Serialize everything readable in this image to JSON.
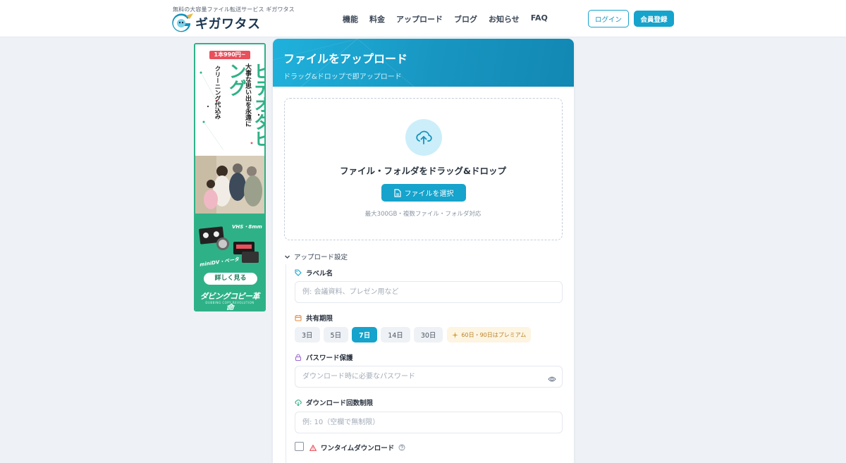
{
  "header": {
    "tagline": "無料の大容量ファイル転送サービス ギガワタス",
    "logo_text": "ギガワタス",
    "nav": [
      "機能",
      "料金",
      "アップロード",
      "ブログ",
      "お知らせ",
      "FAQ"
    ],
    "login_label": "ログイン",
    "register_label": "会員登録"
  },
  "ad": {
    "price": "1本990円~",
    "headline": "ビデオダビング",
    "line1": "大事な思い出を永遠に",
    "line2": "クリーニング代込み",
    "vhs": "VHS・8mm",
    "minidv": "miniDV・ベータ",
    "more_label": "詳しく見る",
    "brand": "ダビングコピー革命",
    "brand_sub": "DUBBING COPY REVOLUTION"
  },
  "panel": {
    "title": "ファイルをアップロード",
    "subtitle": "ドラッグ&ドロップで即アップロード",
    "drop_text": "ファイル・フォルダをドラッグ&ドロップ",
    "select_label": "ファイルを選択",
    "drop_note": "最大300GB・複数ファイル・フォルダ対応"
  },
  "settings": {
    "toggle_label": "アップロード設定",
    "label_name": {
      "label": "ラベル名",
      "placeholder": "例: 会議資料、プレゼン用など"
    },
    "share_period": {
      "label": "共有期限",
      "options": [
        "3日",
        "5日",
        "7日",
        "14日",
        "30日"
      ],
      "selected": "7日",
      "premium_note": "60日・90日はプレミアム"
    },
    "password": {
      "label": "パスワード保護",
      "placeholder": "ダウンロード時に必要なパスワード"
    },
    "download_limit": {
      "label": "ダウンロード回数制限",
      "placeholder": "例: 10（空欄で無制限）"
    },
    "one_time": {
      "label": "ワンタイムダウンロード",
      "checked": false
    }
  },
  "colors": {
    "accent": "#16a3cc",
    "ad_green": "#2fb187",
    "ad_red": "#e8505b",
    "premium": "#b9812a"
  }
}
